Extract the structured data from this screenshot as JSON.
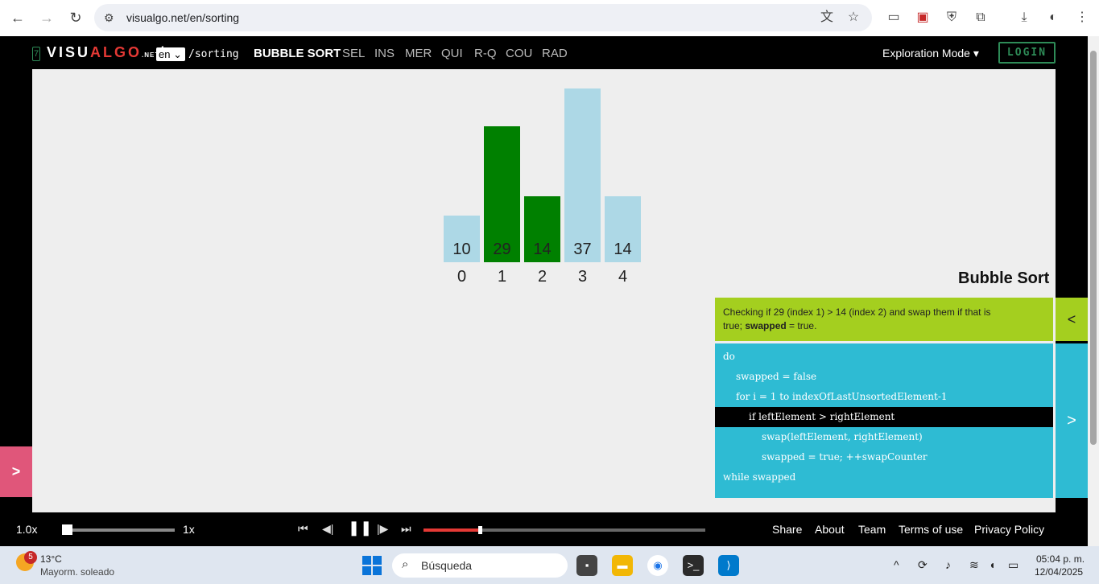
{
  "browser": {
    "url": "visualgo.net/en/sorting"
  },
  "nav": {
    "logo_a": "VISU",
    "logo_b": "ALGO",
    "logo_net": ".NET",
    "logo_slash": "/",
    "language": "en",
    "path": "/sorting",
    "tabs": [
      "BUBBLE SORT",
      "SEL",
      "INS",
      "MER",
      "QUI",
      "R-Q",
      "COU",
      "RAD"
    ],
    "mode": "Exploration Mode ▾",
    "login": "LOGIN"
  },
  "array": {
    "values": [
      10,
      29,
      14,
      37,
      14
    ],
    "indices": [
      "0",
      "1",
      "2",
      "3",
      "4"
    ],
    "max_value": 37,
    "states": [
      "default",
      "compare",
      "compare",
      "default",
      "default"
    ]
  },
  "colors": {
    "default": "#add8e6",
    "compare": "#008000",
    "status_bg": "#a4cf1f",
    "code_bg": "#2ebbd3",
    "accent_red": "#e53935"
  },
  "panel": {
    "title": "Bubble Sort",
    "status_text_1": "Checking if 29 (index 1) > 14 (index 2) and swap them if that is",
    "status_text_2": "true; ",
    "status_bold": "swapped",
    "status_text_3": " = true.",
    "code": [
      {
        "text": "do",
        "indent": 0
      },
      {
        "text": "swapped = false",
        "indent": 1
      },
      {
        "text": "for i = 1 to indexOfLastUnsortedElement-1",
        "indent": 1
      },
      {
        "text": "if leftElement > rightElement",
        "indent": 2
      },
      {
        "text": "swap(leftElement, rightElement)",
        "indent": 3
      },
      {
        "text": "swapped = true; ++swapCounter",
        "indent": 3
      },
      {
        "text": "while swapped",
        "indent": 0
      }
    ],
    "highlighted_line": 3
  },
  "controls": {
    "speed": "1.0x",
    "speed_max": "1x",
    "progress": 0.2
  },
  "footer": {
    "links": [
      "Share",
      "About",
      "Team",
      "Terms of use",
      "Privacy Policy"
    ]
  },
  "taskbar": {
    "weather_badge": "5",
    "weather_temp": "13°C",
    "weather_desc": "Mayorm. soleado",
    "search_placeholder": "Búsqueda",
    "time": "05:04 p. m.",
    "date": "12/04/2025"
  }
}
